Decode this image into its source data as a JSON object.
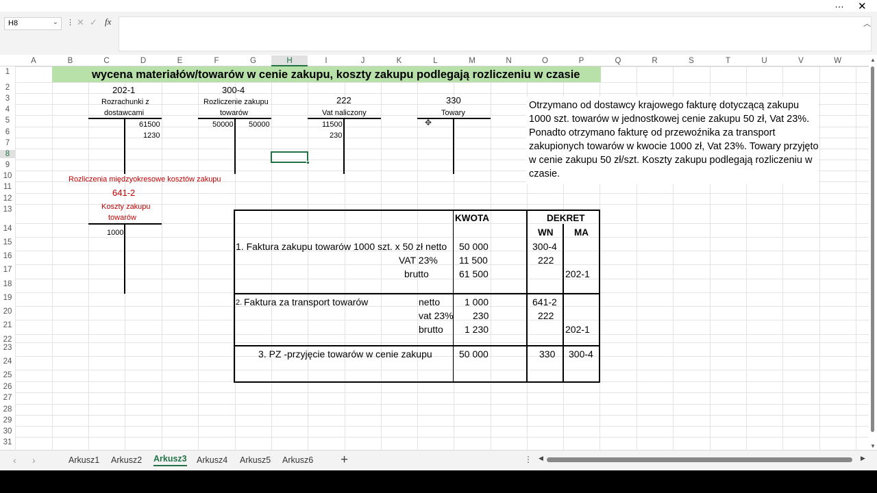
{
  "window": {
    "more_icon": "…",
    "close_icon": "✕"
  },
  "formula_bar": {
    "name_box": "H8",
    "formula": ""
  },
  "columns": [
    "A",
    "B",
    "C",
    "D",
    "E",
    "F",
    "G",
    "H",
    "I",
    "J",
    "K",
    "L",
    "M",
    "N",
    "O",
    "P",
    "Q",
    "R",
    "S",
    "T",
    "U",
    "V",
    "W"
  ],
  "selected_column": "H",
  "rows": [
    "1",
    "2",
    "3",
    "4",
    "5",
    "6",
    "7",
    "8",
    "9",
    "10",
    "11",
    "12",
    "13",
    "14",
    "15",
    "16",
    "17",
    "18",
    "19",
    "20",
    "21",
    "22",
    "23",
    "24",
    "25",
    "26",
    "27",
    "28",
    "29",
    "30",
    "31"
  ],
  "selected_row": "8",
  "title": "wycena materiałów/towarów w cenie zakupu, koszty zakupu podlegają rozliczeniu w czasie",
  "accounts": {
    "a2021": {
      "number": "202-1",
      "name_line1": "Rozrachunki z",
      "name_line2": "dostawcami",
      "credit": [
        "61500",
        "1230"
      ]
    },
    "a3004": {
      "number": "300-4",
      "name_line1": "Rozliczenie zakupu",
      "name_line2": "towarów",
      "debit": [
        "50000"
      ],
      "credit": [
        "50000"
      ]
    },
    "a222": {
      "number": "222",
      "name": "Vat naliczony",
      "debit": [
        "11500",
        "230"
      ]
    },
    "a330": {
      "number": "330",
      "name": "Towary"
    },
    "a6412": {
      "section": "Rozliczenia międzyokresowe kosztów zakupu",
      "number": "641-2",
      "name_line1": "Koszty zakupu",
      "name_line2": "towarów",
      "debit": [
        "1000"
      ]
    }
  },
  "description": "Otrzymano od dostawcy krajowego fakturę dotyczącą zakupu 1000 szt. towarów w jednostkowej cenie zakupu 50 zł, Vat 23%. Ponadto otrzymano fakturę od przewoźnika za transport zakupionych towarów w kwocie 1000 zł, Vat 23%. Towary przyjęto w cenie zakupu 50 zł/szt. Koszty zakupu podlegają rozliczeniu w czasie.",
  "journal": {
    "kwota_header": "KWOTA",
    "dekret_header": "DEKRET",
    "wn_header": "WN",
    "ma_header": "MA",
    "e1": {
      "desc": "1. Faktura zakupu towarów 1000 szt. x 50 zł netto",
      "vat_label": "VAT 23%",
      "brutto_label": "brutto",
      "netto": "50 000",
      "vat": "11 500",
      "brutto": "61 500",
      "wn1": "300-4",
      "wn2": "222",
      "ma": "202-1"
    },
    "e2": {
      "num": "2.",
      "desc": "Faktura za transport towarów",
      "netto_label": "netto",
      "vat_label": "vat 23%",
      "brutto_label": "brutto",
      "netto": "1 000",
      "vat": "230",
      "brutto": "1 230",
      "wn1": "641-2",
      "wn2": "222",
      "ma": "202-1"
    },
    "e3": {
      "desc": "3. PZ -przyjęcie towarów w cenie zakupu",
      "amount": "50 000",
      "wn": "330",
      "ma": "300-4"
    }
  },
  "sheets": [
    "Arkusz1",
    "Arkusz2",
    "Arkusz3",
    "Arkusz4",
    "Arkusz5",
    "Arkusz6"
  ],
  "active_sheet": "Arkusz3",
  "add_sheet_icon": "+"
}
